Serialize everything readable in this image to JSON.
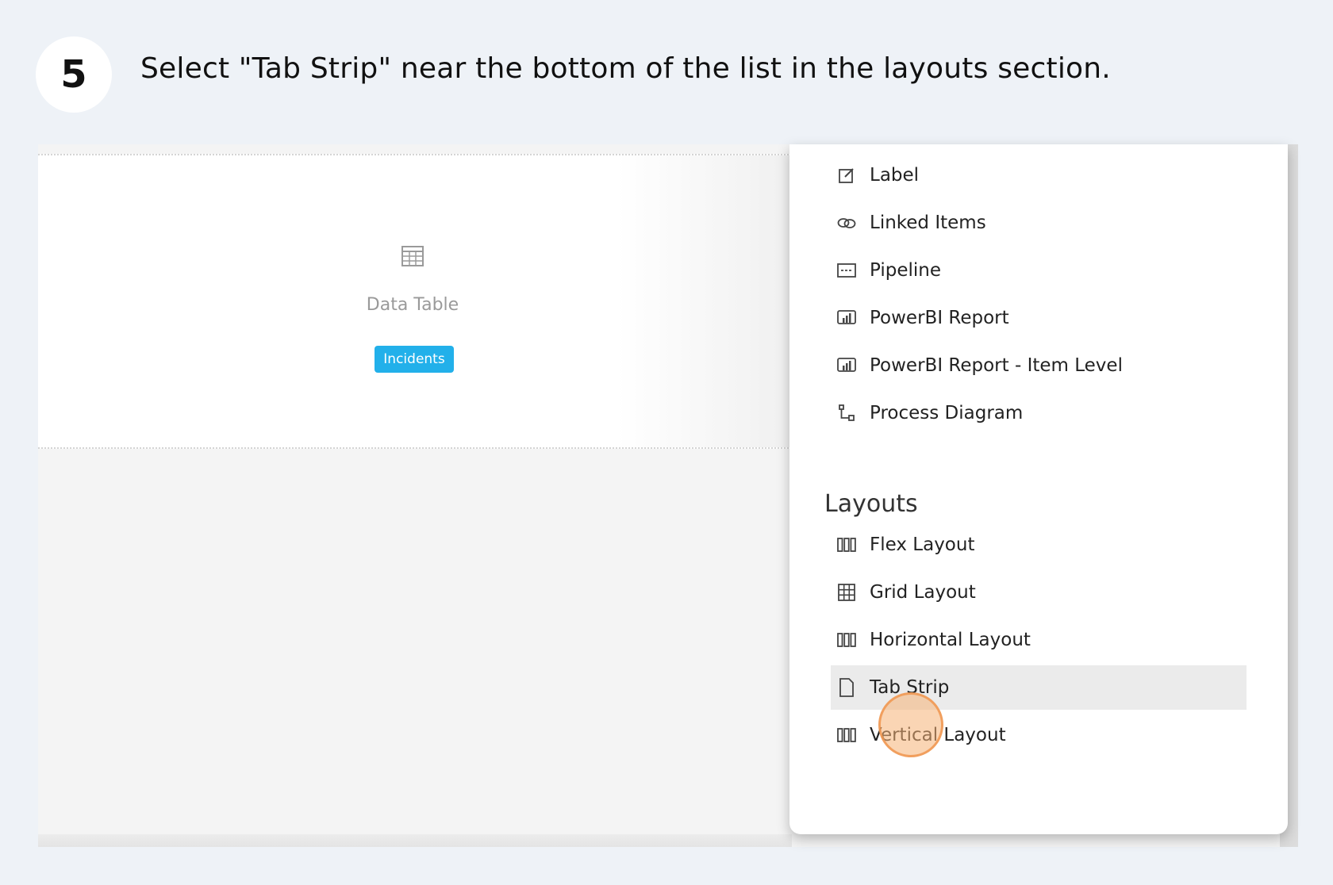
{
  "step": {
    "number": "5",
    "instruction": "Select \"Tab Strip\" near the bottom of the list in the layouts section."
  },
  "canvas": {
    "widget_name": "Data Table",
    "entity_badge": "Incidents",
    "widget_icon": "table-icon"
  },
  "menu": {
    "items_top": [
      {
        "label": "Label",
        "icon": "edit-icon"
      },
      {
        "label": "Linked Items",
        "icon": "link-icon"
      },
      {
        "label": "Pipeline",
        "icon": "pipeline-icon"
      },
      {
        "label": "PowerBI Report",
        "icon": "report-chart-icon"
      },
      {
        "label": "PowerBI Report - Item Level",
        "icon": "report-chart-icon"
      },
      {
        "label": "Process Diagram",
        "icon": "process-diagram-icon"
      }
    ],
    "layouts_title": "Layouts",
    "layouts": [
      {
        "label": "Flex Layout",
        "icon": "columns-icon"
      },
      {
        "label": "Grid Layout",
        "icon": "grid-icon"
      },
      {
        "label": "Horizontal Layout",
        "icon": "columns-icon"
      },
      {
        "label": "Tab Strip",
        "icon": "page-icon",
        "highlighted": true
      },
      {
        "label": "Vertical Layout",
        "icon": "columns-icon"
      }
    ]
  },
  "colors": {
    "background": "#eef2f7",
    "badge": "#22b0ea",
    "highlight": "#ebebeb",
    "click_indicator": "#f6b276"
  }
}
